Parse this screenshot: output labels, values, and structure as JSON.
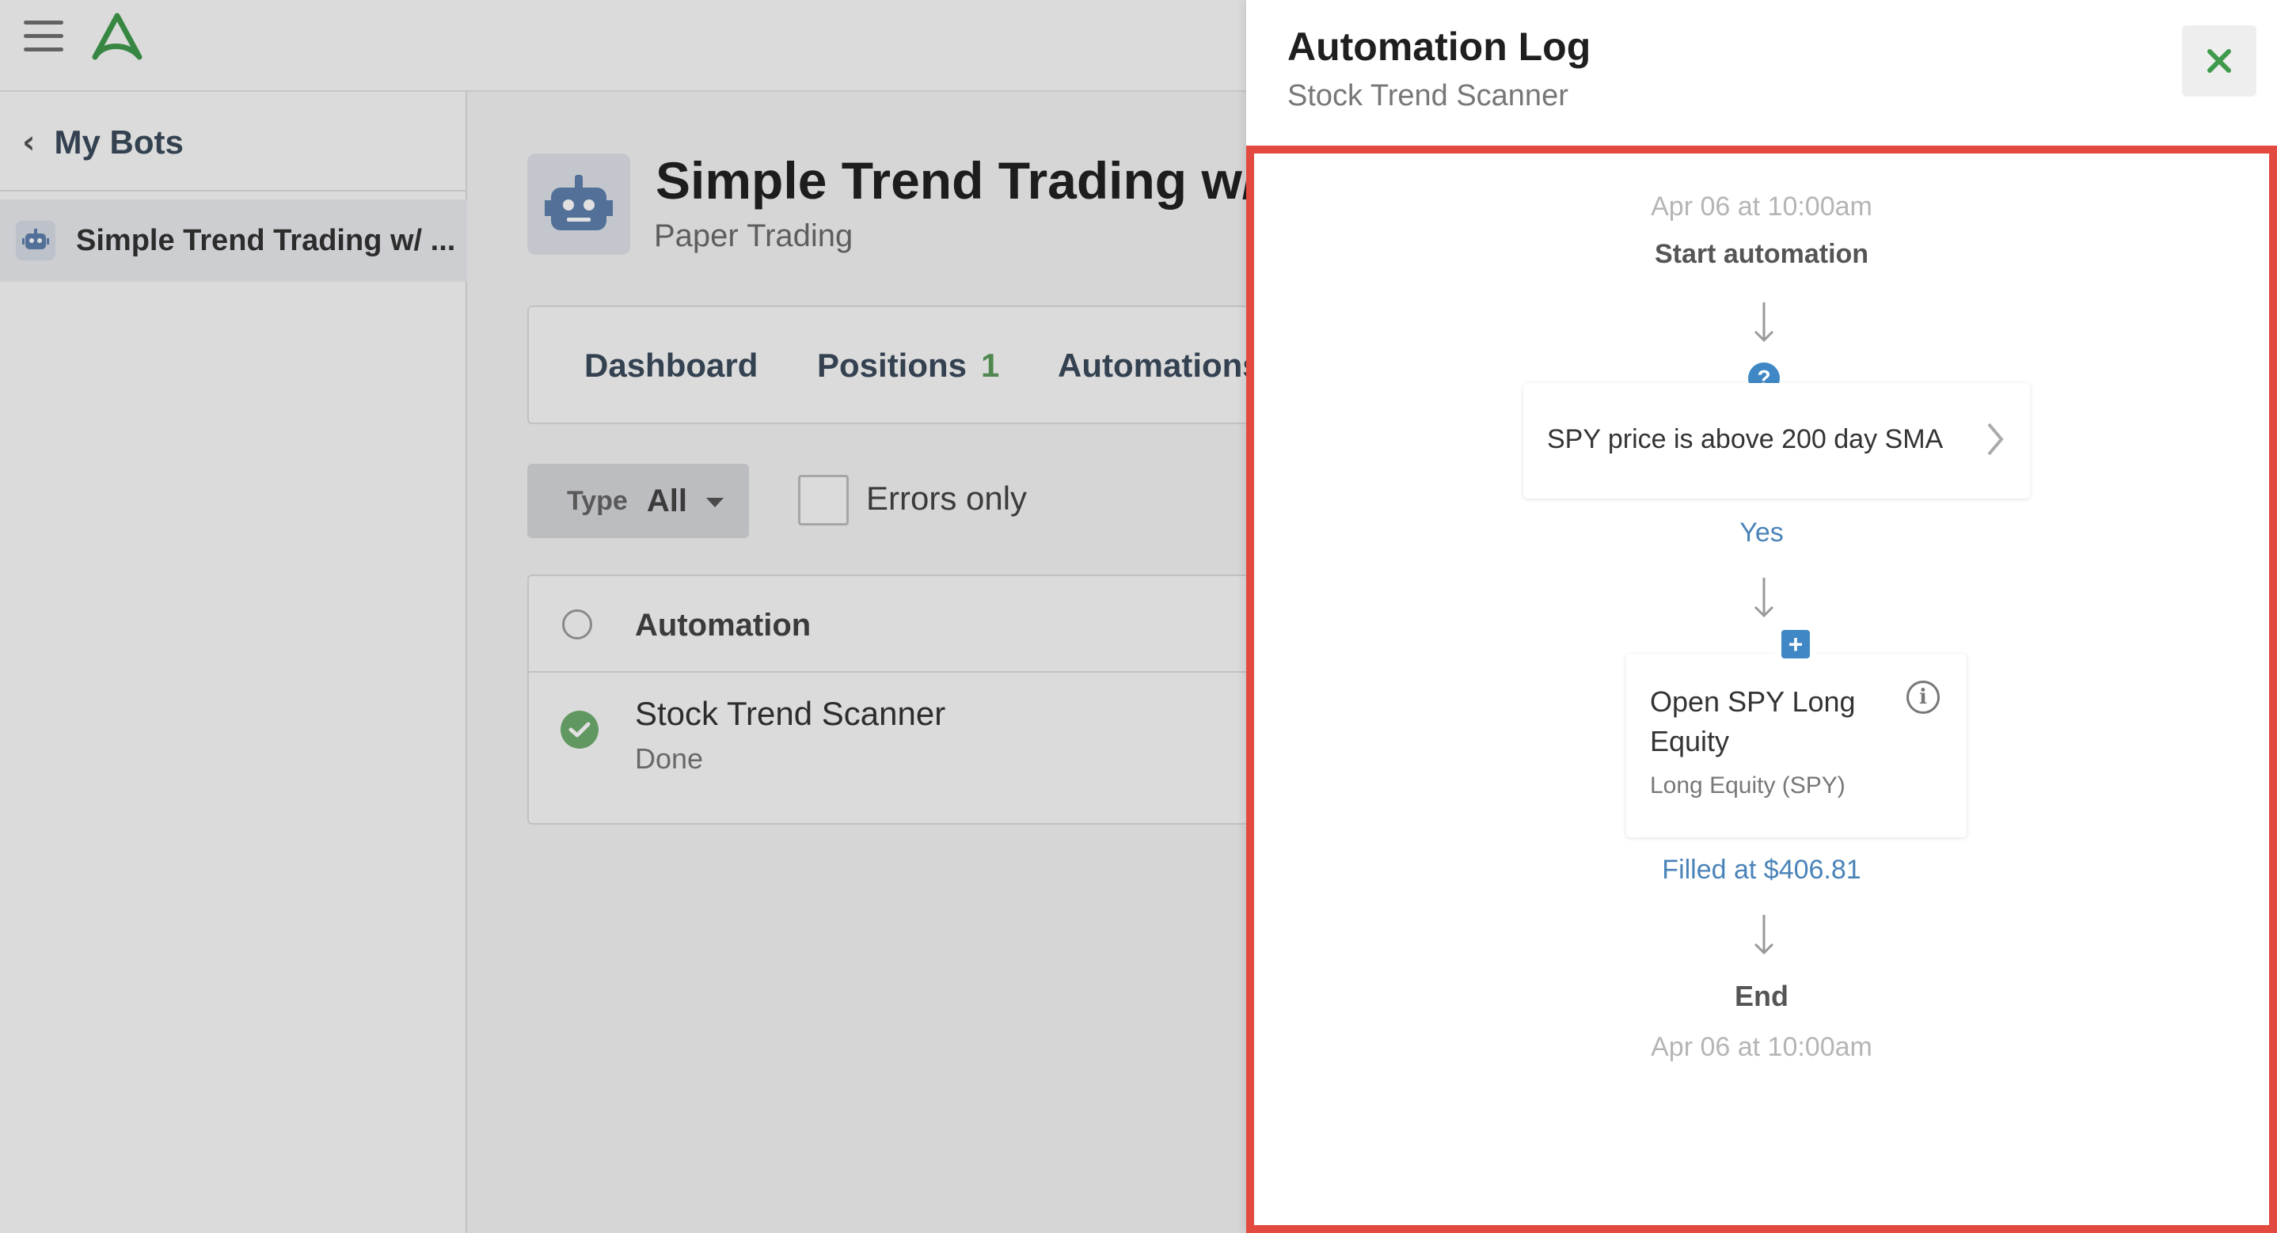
{
  "app": {
    "sidebar": {
      "back_label": "My Bots",
      "items": [
        {
          "label": "Simple Trend Trading w/ ..."
        }
      ]
    },
    "bot": {
      "title": "Simple Trend Trading w/",
      "subtitle": "Paper Trading"
    },
    "tabs": [
      {
        "label": "Dashboard"
      },
      {
        "label": "Positions",
        "count": "1"
      },
      {
        "label": "Automations"
      }
    ],
    "filters": {
      "type_label": "Type",
      "type_value": "All",
      "errors_only_label": "Errors only",
      "errors_only_checked": false
    },
    "list": {
      "header": "Automation",
      "rows": [
        {
          "name": "Stock Trend Scanner",
          "status": "Done"
        }
      ]
    }
  },
  "drawer": {
    "title": "Automation Log",
    "subtitle": "Stock Trend Scanner",
    "close_icon": "close-icon",
    "log": {
      "start_timestamp": "Apr 06 at 10:00am",
      "start_label": "Start automation",
      "condition": {
        "icon": "question-icon",
        "text": "SPY price is above 200 day SMA"
      },
      "condition_result": "Yes",
      "action": {
        "icon": "plus-icon",
        "title": "Open SPY Long Equity",
        "subtitle": "Long Equity (SPY)"
      },
      "action_result": "Filled at $406.81",
      "end_label": "End",
      "end_timestamp": "Apr 06 at 10:00am"
    }
  },
  "colors": {
    "accent_green": "#5c9a5c",
    "brand_blue": "#3f88c5",
    "link_blue": "#4a83b8",
    "highlight_red": "#e34a3f",
    "close_green": "#3f9a4c"
  }
}
